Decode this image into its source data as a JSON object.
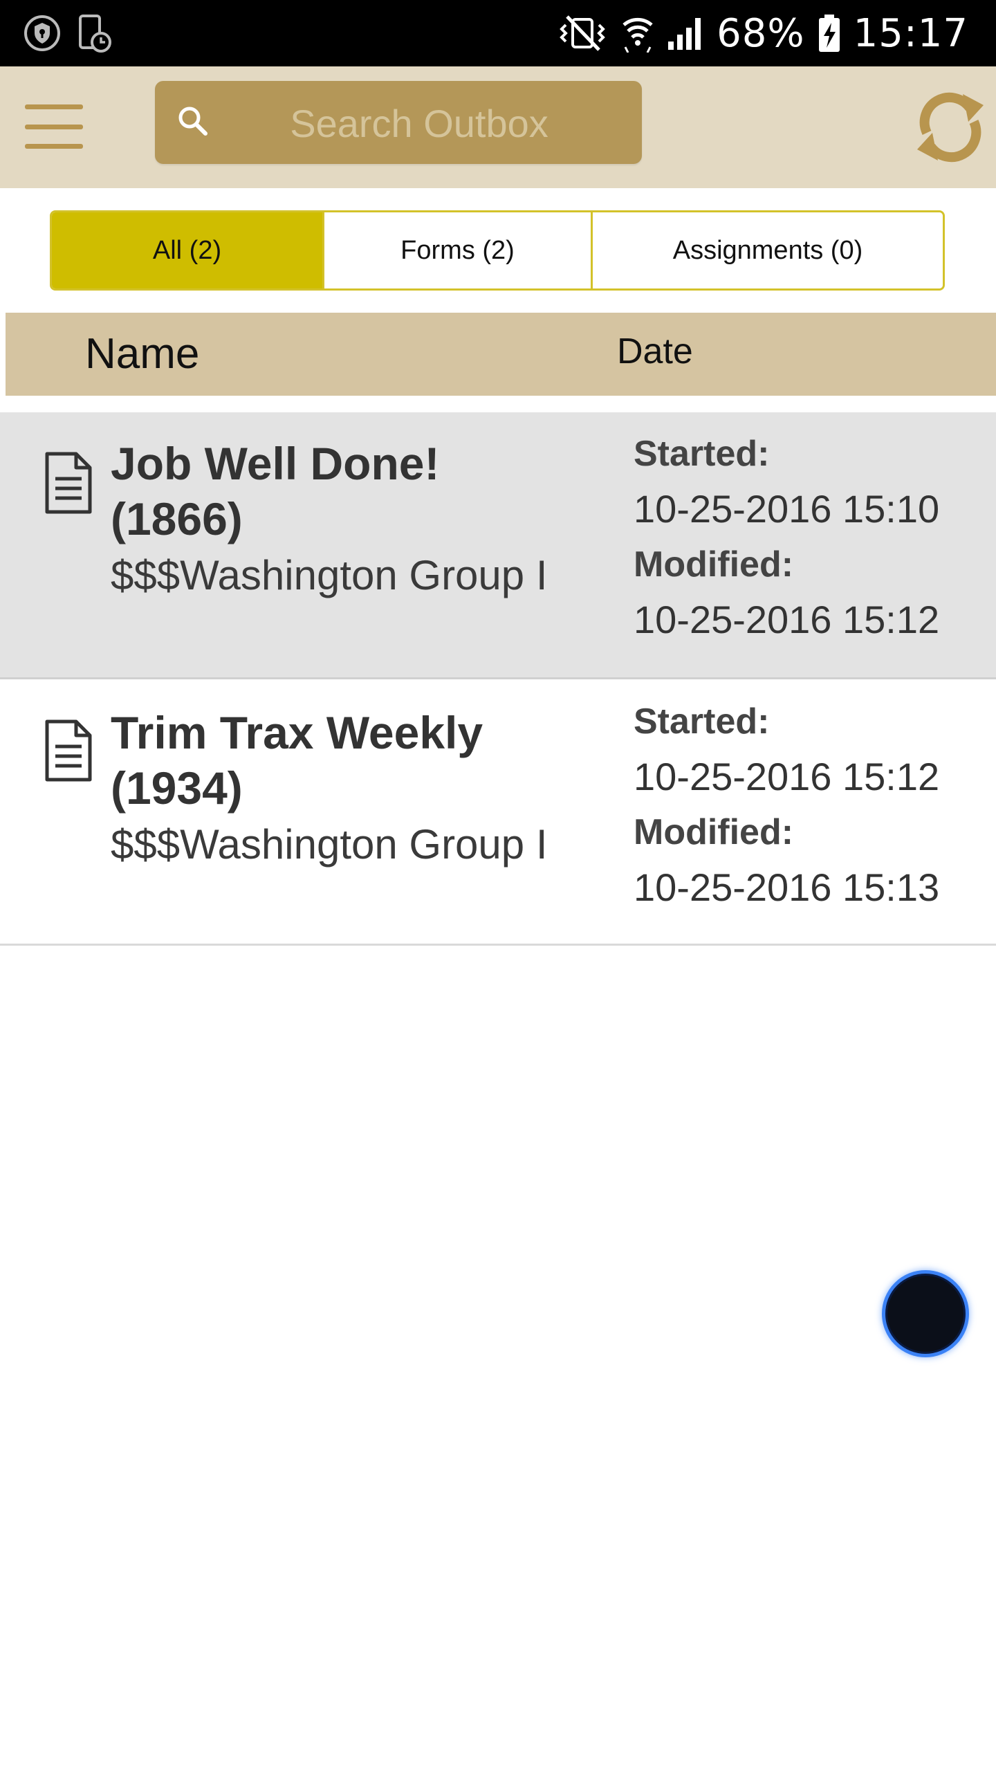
{
  "status_bar": {
    "battery": "68%",
    "time": "15:17",
    "icons": [
      "vpn-shield-icon",
      "screen-time-icon",
      "vibrate-mute-icon",
      "wifi-icon",
      "signal-icon",
      "battery-charging-icon"
    ]
  },
  "app_bar": {
    "search_placeholder": "Search Outbox",
    "icons": [
      "hamburger-menu-icon",
      "search-icon",
      "refresh-icon"
    ],
    "accent_color": "#b49758"
  },
  "tabs": [
    {
      "label": "All (2)",
      "active": true
    },
    {
      "label": "Forms (2)",
      "active": false
    },
    {
      "label": "Assignments (0)",
      "active": false
    }
  ],
  "columns": {
    "name": "Name",
    "date": "Date"
  },
  "rows": [
    {
      "title_line1": "Job Well Done!",
      "title_line2": "(1866)",
      "subtitle": "$$$Washington Group I",
      "started_label": "Started:",
      "started": "10-25-2016 15:10",
      "modified_label": "Modified:",
      "modified": "10-25-2016 15:12",
      "selected": true
    },
    {
      "title_line1": "Trim Trax Weekly",
      "title_line2": "(1934)",
      "subtitle": "$$$Washington Group I",
      "started_label": "Started:",
      "started": "10-25-2016 15:12",
      "modified_label": "Modified:",
      "modified": "10-25-2016 15:13",
      "selected": false
    }
  ],
  "colors": {
    "app_bar_bg": "#e3d9c2",
    "active_tab": "#cfbd00",
    "header_bg": "#d5c4a1",
    "selected_row_bg": "#e3e3e3"
  }
}
